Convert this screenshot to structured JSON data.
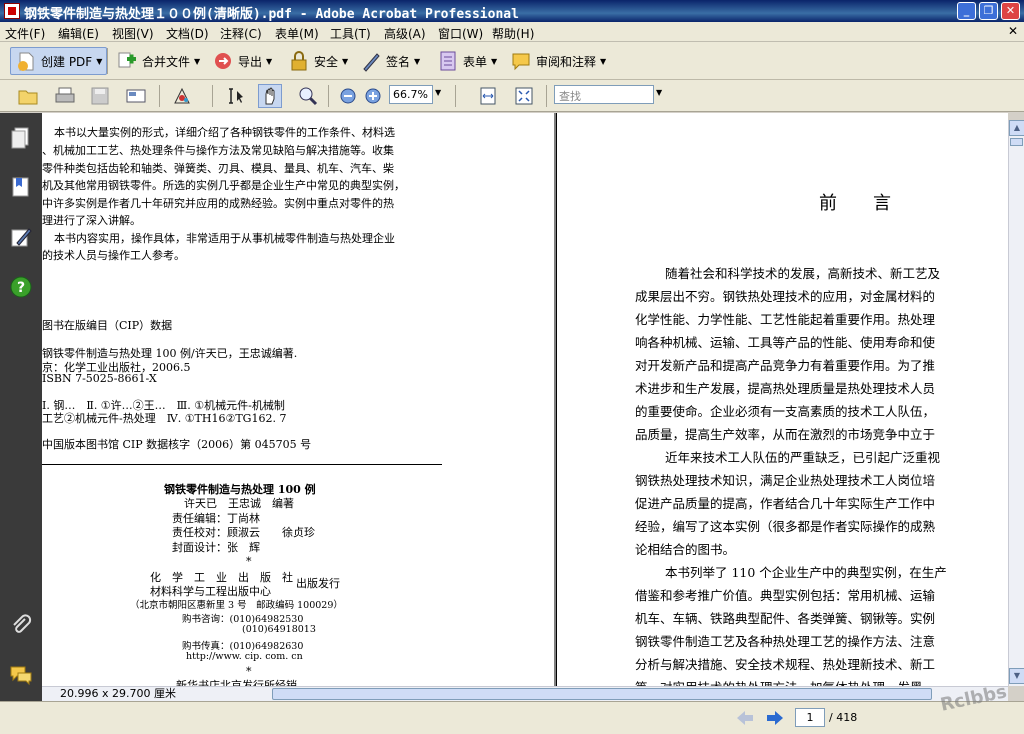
{
  "window": {
    "title": "钢铁零件制造与热处理１００例(清晰版).pdf - Adobe Acrobat Professional"
  },
  "menu": [
    {
      "label": "文件(F)"
    },
    {
      "label": "编辑(E)"
    },
    {
      "label": "视图(V)"
    },
    {
      "label": "文档(D)"
    },
    {
      "label": "注释(C)"
    },
    {
      "label": "表单(M)"
    },
    {
      "label": "工具(T)"
    },
    {
      "label": "高级(A)"
    },
    {
      "label": "窗口(W)"
    },
    {
      "label": "帮助(H)"
    }
  ],
  "task_toolbar": [
    {
      "label": "创建 PDF"
    },
    {
      "label": "合并文件"
    },
    {
      "label": "导出"
    },
    {
      "label": "安全"
    },
    {
      "label": "签名"
    },
    {
      "label": "表单"
    },
    {
      "label": "审阅和注释"
    }
  ],
  "toolbar": {
    "zoom": "66.7%",
    "search_placeholder": "查找"
  },
  "page_size": "20.996 x 29.700 厘米",
  "navigation": {
    "current_page": "1",
    "total_pages": "/ 418"
  },
  "watermark": "Rclbbs",
  "left_page": {
    "intro": [
      "本书以大量实例的形式，详细介绍了各种钢铁零件的工作条件、材料选",
      "、机械加工工艺、热处理条件与操作方法及常见缺陷与解决措施等。收集",
      "零件种类包括齿轮和轴类、弹簧类、刃具、模具、量具、机车、汽车、柴",
      "机及其他常用钢铁零件。所选的实例几乎都是企业生产中常见的典型实例，",
      "中许多实例是作者几十年研究并应用的成熟经验。实例中重点对零件的热",
      "理进行了深入讲解。",
      "本书内容实用，操作具体，非常适用于从事机械零件制造与热处理企业",
      "的技术人员与操作工人参考。"
    ],
    "cip_title": "图书在版编目（CIP）数据",
    "cip": [
      "钢铁零件制造与热处理 100 例/许天已，王忠诚编著.",
      "京：化学工业出版社，2006.5",
      "ISBN 7-5025-8661-X"
    ],
    "classification": [
      "Ⅰ. 钢…　Ⅱ. ①许…②王…　Ⅲ. ①机械元件-机械制",
      "工艺②机械元件-热处理　Ⅳ. ①TH16②TG162. 7"
    ],
    "cip_number": "中国版本图书馆 CIP 数据核字（2006）第 045705 号",
    "book_title": "钢铁零件制造与热处理 100 例",
    "authors": "许天已　王忠诚　编著",
    "editor": "责任编辑：丁尚林",
    "proofreader": "责任校对：顾淑云　　徐贞珍",
    "cover_design": "封面设计：张　辉",
    "star": "*",
    "publisher": "化　学　工　业　出　版　社",
    "center": "材料科学与工程出版中心",
    "issue": "出版发行",
    "address": "（北京市朝阳区惠新里 3 号　邮政编码 100029）",
    "phone1": "购书咨询：(010)64982530",
    "phone2": "(010)64918013",
    "fax": "购书传真：(010)64982630",
    "website": "http://www. cip. com. cn",
    "star2": "*",
    "distributor": "新华书店北京发行所经销"
  },
  "right_page": {
    "heading": "前　　言",
    "lines": [
      "随着社会和科学技术的发展，高新技术、新工艺及",
      "成果层出不穷。钢铁热处理技术的应用，对金属材料的",
      "化学性能、力学性能、工艺性能起着重要作用。热处理",
      "响各种机械、运输、工具等产品的性能、使用寿命和使",
      "对开发新产品和提高产品竞争力有着重要作用。为了推",
      "术进步和生产发展，提高热处理质量是热处理技术人员",
      "的重要使命。企业必须有一支高素质的技术工人队伍，",
      "品质量，提高生产效率，从而在激烈的市场竞争中立于",
      "近年来技术工人队伍的严重缺乏，已引起广泛重视",
      "钢铁热处理技术知识，满足企业热处理技术工人岗位培",
      "促进产品质量的提高，作者结合几十年实际生产工作中",
      "经验，编写了这本实例（很多都是作者实际操作的成熟",
      "论相结合的图书。",
      "本书列举了 110 个企业生产中的典型实例，在生产",
      "借鉴和参考推广价值。典型实例包括：常用机械、运输",
      "机车、车辆、铁路典型配件、各类弹簧、钢锹等。实例",
      "钢铁零件制造工艺及各种热处理工艺的操作方法、注意",
      "分析与解决措施、安全技术规程、热处理新技术、新工",
      "等。对实用技术的热处理方法、加氧体热处理、发黑"
    ]
  }
}
